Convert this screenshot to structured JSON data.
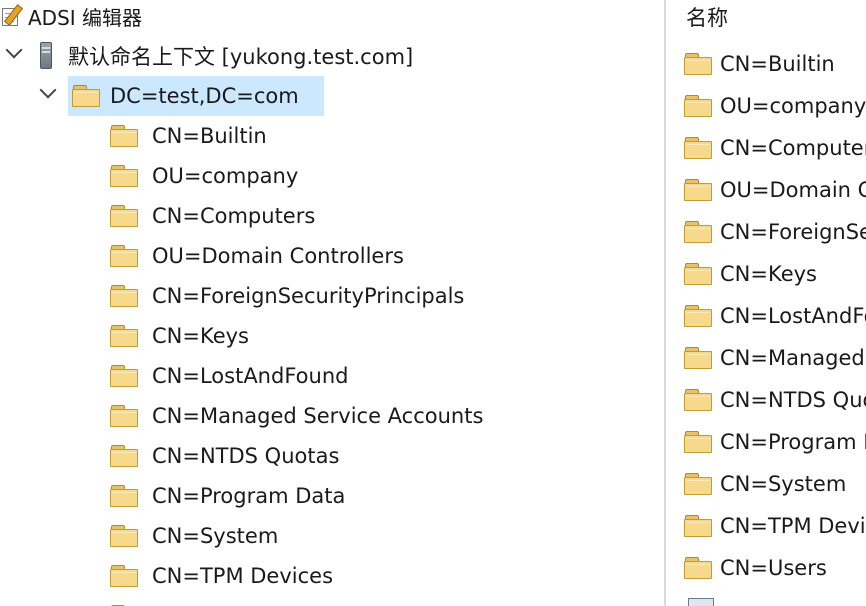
{
  "tree": {
    "root": {
      "label": "ADSI 编辑器",
      "icon": "adsi-edit-icon"
    },
    "connection": {
      "label": "默认命名上下文 [yukong.test.com]",
      "icon": "server-icon"
    },
    "domain": {
      "label": "DC=test,DC=com",
      "icon": "folder-icon"
    },
    "children": [
      "CN=Builtin",
      "OU=company",
      "CN=Computers",
      "OU=Domain Controllers",
      "CN=ForeignSecurityPrincipals",
      "CN=Keys",
      "CN=LostAndFound",
      "CN=Managed Service Accounts",
      "CN=NTDS Quotas",
      "CN=Program Data",
      "CN=System",
      "CN=TPM Devices"
    ]
  },
  "list": {
    "column_header": "名称",
    "items": [
      "CN=Builtin",
      "OU=company",
      "CN=Computers",
      "OU=Domain Controllers",
      "CN=ForeignSecurityPrincipals",
      "CN=Keys",
      "CN=LostAndFound",
      "CN=Managed Service Accounts",
      "CN=NTDS Quotas",
      "CN=Program Data",
      "CN=System",
      "CN=TPM Devices",
      "CN=Users"
    ]
  },
  "colors": {
    "selection": "#cce8ff",
    "folder": "#f6d98a",
    "splitter": "#d9d9d9"
  }
}
